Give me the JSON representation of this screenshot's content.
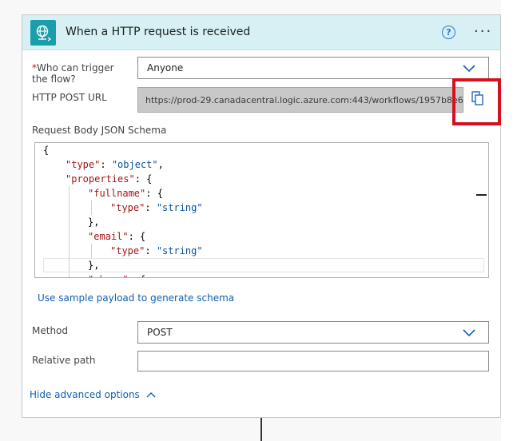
{
  "card": {
    "title": "When a HTTP request is received",
    "trigger_color": "#1a9ea9",
    "help_label": "?",
    "more_label": "···"
  },
  "who_can_trigger": {
    "required_mark": "*",
    "label": "Who can trigger the flow?",
    "value": "Anyone"
  },
  "http_post_url": {
    "label": "HTTP POST URL",
    "value": "https://prod-29.canadacentral.logic.azure.com:443/workflows/1957b8e6..."
  },
  "schema": {
    "label": "Request Body JSON Schema",
    "lines": [
      "{",
      "\"type\": \"object\",",
      "\"properties\": {",
      "\"fullname\": {",
      "\"type\": \"string\"",
      "},",
      "\"email\": {",
      "\"type\": \"string\"",
      "},",
      "\"phone\": {"
    ]
  },
  "sample_payload_link": "Use sample payload to generate schema",
  "method": {
    "label": "Method",
    "value": "POST"
  },
  "relative_path": {
    "label": "Relative path",
    "value": ""
  },
  "hide_advanced": "Hide advanced options"
}
